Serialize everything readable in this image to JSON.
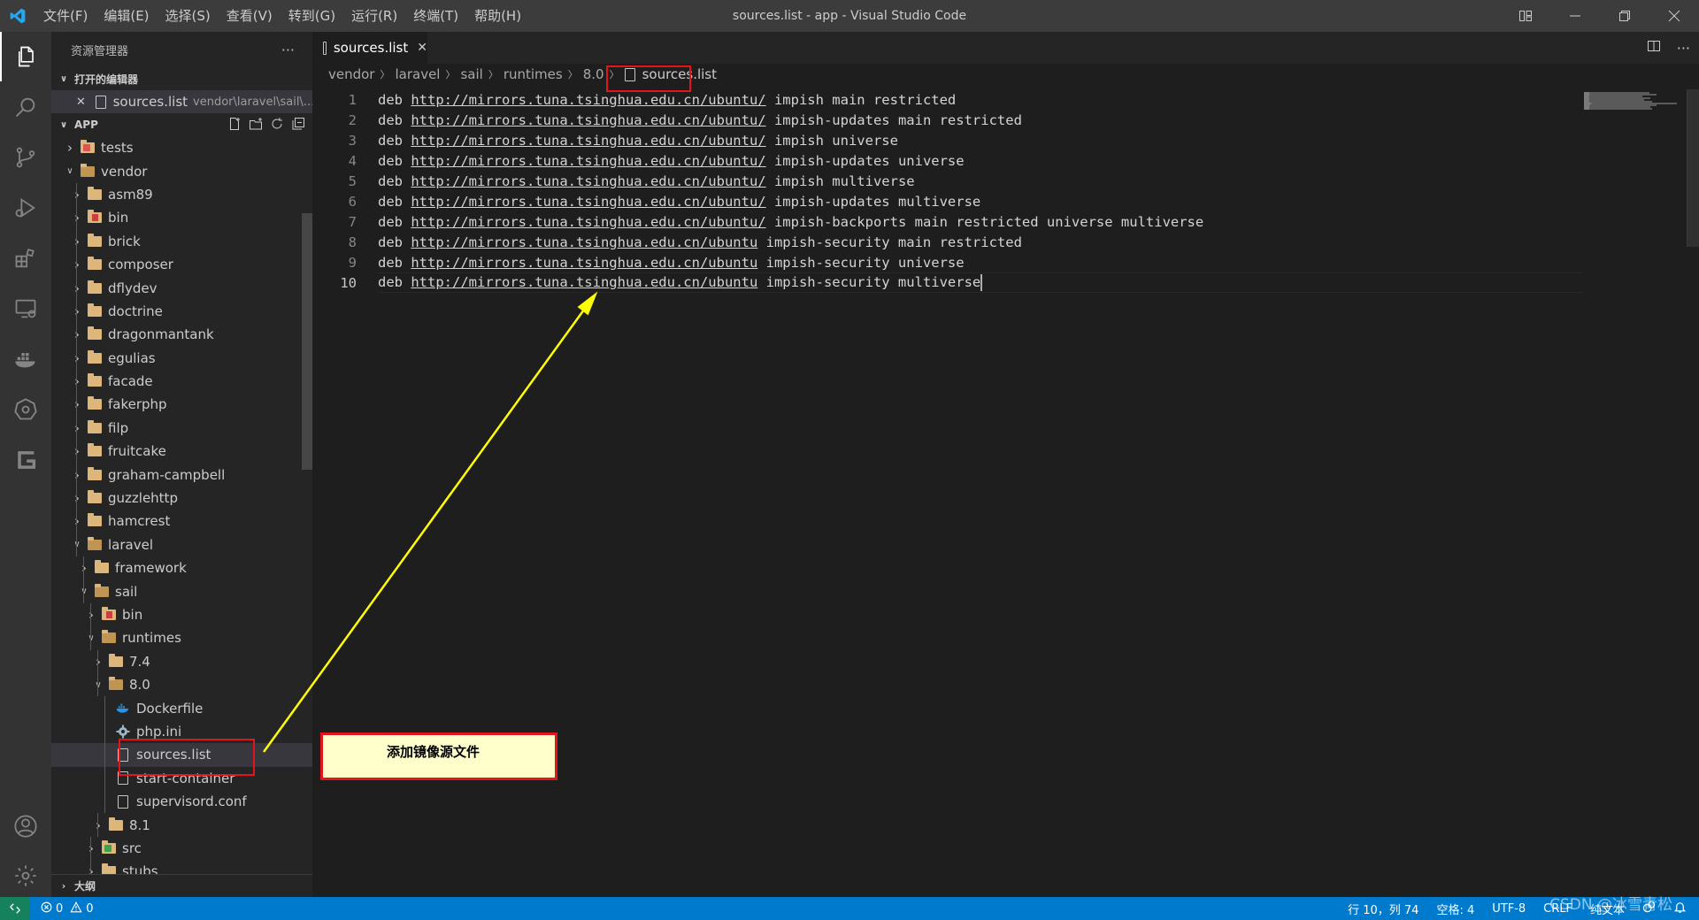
{
  "window": {
    "title": "sources.list - app - Visual Studio Code",
    "menu": [
      "文件(F)",
      "编辑(E)",
      "选择(S)",
      "查看(V)",
      "转到(G)",
      "运行(R)",
      "终端(T)",
      "帮助(H)"
    ]
  },
  "sidebar": {
    "title": "资源管理器",
    "more": "···",
    "open_editors_header": "打开的编辑器",
    "open_editor": {
      "name": "sources.list",
      "path": "vendor\\laravel\\sail\\..."
    },
    "app_header": "APP",
    "outline_header": "大纲",
    "tree": [
      {
        "label": "tests",
        "depth": 0,
        "open": false,
        "kind": "folder-red"
      },
      {
        "label": "vendor",
        "depth": 0,
        "open": true,
        "kind": "folder"
      },
      {
        "label": "asm89",
        "depth": 1,
        "open": false,
        "kind": "folder"
      },
      {
        "label": "bin",
        "depth": 1,
        "open": false,
        "kind": "folder-bin"
      },
      {
        "label": "brick",
        "depth": 1,
        "open": false,
        "kind": "folder"
      },
      {
        "label": "composer",
        "depth": 1,
        "open": false,
        "kind": "folder"
      },
      {
        "label": "dflydev",
        "depth": 1,
        "open": false,
        "kind": "folder"
      },
      {
        "label": "doctrine",
        "depth": 1,
        "open": false,
        "kind": "folder"
      },
      {
        "label": "dragonmantank",
        "depth": 1,
        "open": false,
        "kind": "folder"
      },
      {
        "label": "egulias",
        "depth": 1,
        "open": false,
        "kind": "folder"
      },
      {
        "label": "facade",
        "depth": 1,
        "open": false,
        "kind": "folder"
      },
      {
        "label": "fakerphp",
        "depth": 1,
        "open": false,
        "kind": "folder"
      },
      {
        "label": "filp",
        "depth": 1,
        "open": false,
        "kind": "folder"
      },
      {
        "label": "fruitcake",
        "depth": 1,
        "open": false,
        "kind": "folder"
      },
      {
        "label": "graham-campbell",
        "depth": 1,
        "open": false,
        "kind": "folder"
      },
      {
        "label": "guzzlehttp",
        "depth": 1,
        "open": false,
        "kind": "folder"
      },
      {
        "label": "hamcrest",
        "depth": 1,
        "open": false,
        "kind": "folder"
      },
      {
        "label": "laravel",
        "depth": 1,
        "open": true,
        "kind": "folder"
      },
      {
        "label": "framework",
        "depth": 2,
        "open": false,
        "kind": "folder"
      },
      {
        "label": "sail",
        "depth": 2,
        "open": true,
        "kind": "folder"
      },
      {
        "label": "bin",
        "depth": 3,
        "open": false,
        "kind": "folder-bin"
      },
      {
        "label": "runtimes",
        "depth": 3,
        "open": true,
        "kind": "folder"
      },
      {
        "label": "7.4",
        "depth": 4,
        "open": false,
        "kind": "folder"
      },
      {
        "label": "8.0",
        "depth": 4,
        "open": true,
        "kind": "folder"
      },
      {
        "label": "Dockerfile",
        "depth": 5,
        "open": null,
        "kind": "docker"
      },
      {
        "label": "php.ini",
        "depth": 5,
        "open": null,
        "kind": "gear"
      },
      {
        "label": "sources.list",
        "depth": 5,
        "open": null,
        "kind": "file",
        "selected": true
      },
      {
        "label": "start-container",
        "depth": 5,
        "open": null,
        "kind": "file"
      },
      {
        "label": "supervisord.conf",
        "depth": 5,
        "open": null,
        "kind": "file"
      },
      {
        "label": "8.1",
        "depth": 4,
        "open": false,
        "kind": "folder"
      },
      {
        "label": "src",
        "depth": 3,
        "open": false,
        "kind": "folder-green"
      },
      {
        "label": "stubs",
        "depth": 3,
        "open": false,
        "kind": "folder"
      }
    ]
  },
  "editor": {
    "tab": {
      "label": "sources.list",
      "close": "✕"
    },
    "breadcrumbs": [
      "vendor",
      "laravel",
      "sail",
      "runtimes",
      "8.0"
    ],
    "breadcrumb_file": "sources.list",
    "lines": [
      {
        "n": "1",
        "kw": "deb",
        "url": "http://mirrors.tuna.tsinghua.edu.cn/ubuntu/",
        "rest": "impish main restricted"
      },
      {
        "n": "2",
        "kw": "deb",
        "url": "http://mirrors.tuna.tsinghua.edu.cn/ubuntu/",
        "rest": "impish-updates main restricted"
      },
      {
        "n": "3",
        "kw": "deb",
        "url": "http://mirrors.tuna.tsinghua.edu.cn/ubuntu/",
        "rest": "impish universe"
      },
      {
        "n": "4",
        "kw": "deb",
        "url": "http://mirrors.tuna.tsinghua.edu.cn/ubuntu/",
        "rest": "impish-updates universe"
      },
      {
        "n": "5",
        "kw": "deb",
        "url": "http://mirrors.tuna.tsinghua.edu.cn/ubuntu/",
        "rest": "impish multiverse"
      },
      {
        "n": "6",
        "kw": "deb",
        "url": "http://mirrors.tuna.tsinghua.edu.cn/ubuntu/",
        "rest": "impish-updates multiverse"
      },
      {
        "n": "7",
        "kw": "deb",
        "url": "http://mirrors.tuna.tsinghua.edu.cn/ubuntu/",
        "rest": "impish-backports main restricted universe multiverse"
      },
      {
        "n": "8",
        "kw": "deb",
        "url": "http://mirrors.tuna.tsinghua.edu.cn/ubuntu",
        "rest": "impish-security main restricted"
      },
      {
        "n": "9",
        "kw": "deb",
        "url": "http://mirrors.tuna.tsinghua.edu.cn/ubuntu",
        "rest": "impish-security universe"
      },
      {
        "n": "10",
        "kw": "deb",
        "url": "http://mirrors.tuna.tsinghua.edu.cn/ubuntu",
        "rest": "impish-security multiverse"
      }
    ]
  },
  "statusbar": {
    "errors": "0",
    "warnings": "0",
    "position": "行 10，列 74",
    "spaces": "空格: 4",
    "encoding": "UTF-8",
    "eol": "CRLF",
    "language": "纯文本"
  },
  "annotation": {
    "callout_text": "添加镜像源文件",
    "watermark": "CSDN @冰雪青松",
    "highlight_color": "#e4151a",
    "arrow_color": "#ffff00"
  },
  "colors": {
    "accent": "#007acc",
    "remote": "#16825d",
    "folder": "#dcb67a"
  }
}
